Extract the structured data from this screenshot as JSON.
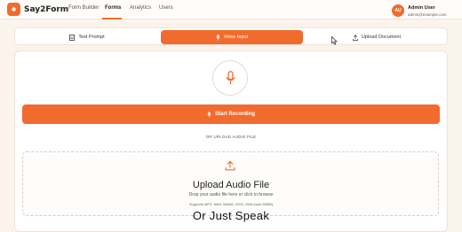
{
  "brand": {
    "name": "Say2Form",
    "accent": "#f26b2e"
  },
  "nav": {
    "items": [
      {
        "label": "Form Builder"
      },
      {
        "label": "Forms",
        "active": true
      },
      {
        "label": "Analytics"
      },
      {
        "label": "Users"
      }
    ]
  },
  "user": {
    "initials": "AU",
    "name": "Admin User",
    "email": "admin@example.com"
  },
  "tabs": [
    {
      "label": "Text Prompt",
      "icon": "document-icon"
    },
    {
      "label": "Voice Input",
      "icon": "microphone-icon",
      "active": true
    },
    {
      "label": "Upload Document",
      "icon": "upload-icon"
    }
  ],
  "voice": {
    "mic_icon": "microphone-icon",
    "record_label": "Start Recording",
    "or_label": "OR UPLOAD AUDIO FILE"
  },
  "upload": {
    "title": "Upload Audio File",
    "subtitle": "Drop your audio file here or click to browse",
    "formats": "Supports MP3, WAV, WebM, OGG, M4A (max 50MB)"
  },
  "caption": "Or Just Speak"
}
